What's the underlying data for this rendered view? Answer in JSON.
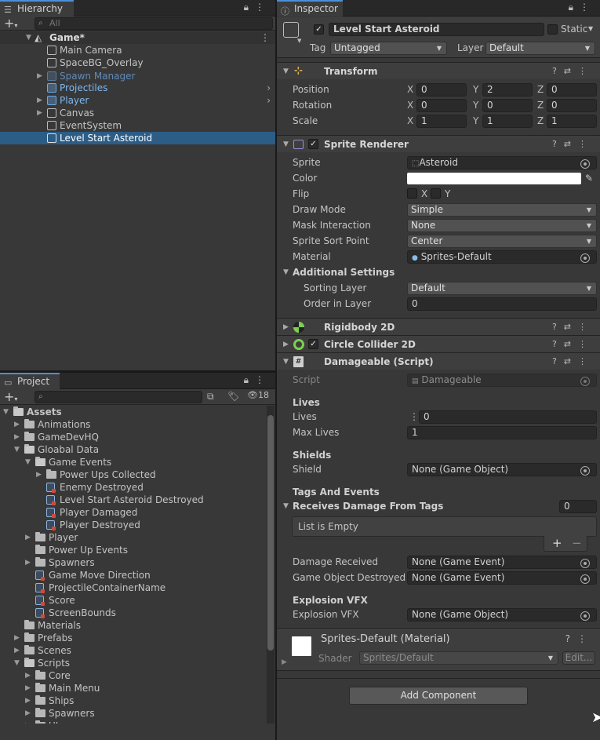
{
  "hierarchy": {
    "tab": "Hierarchy",
    "search_placeholder": "All",
    "scene": "Game*",
    "items": [
      {
        "label": "Main Camera"
      },
      {
        "label": "SpaceBG_Overlay"
      },
      {
        "label": "Spawn Manager"
      },
      {
        "label": "Projectiles"
      },
      {
        "label": "Player"
      },
      {
        "label": "Canvas"
      },
      {
        "label": "EventSystem"
      },
      {
        "label": "Level Start Asteroid"
      }
    ]
  },
  "project": {
    "tab": "Project",
    "count": "18",
    "items": [
      "Assets",
      "Animations",
      "GameDevHQ",
      "Gloabal Data",
      "Game Events",
      "Power Ups Collected",
      "Enemy Destroyed",
      "Level Start Asteroid Destroyed",
      "Player Damaged",
      "Player Destroyed",
      "Player",
      "Power Up Events",
      "Spawners",
      "Game Move Direction",
      "ProjectileContainerName",
      "Score",
      "ScreenBounds",
      "Materials",
      "Prefabs",
      "Scenes",
      "Scripts",
      "Core",
      "Main Menu",
      "Ships",
      "Spawners",
      "UI"
    ]
  },
  "inspector": {
    "tab": "Inspector",
    "object_name": "Level Start Asteroid",
    "static_label": "Static",
    "tag_label": "Tag",
    "tag_value": "Untagged",
    "layer_label": "Layer",
    "layer_value": "Default",
    "transform": {
      "title": "Transform",
      "position_label": "Position",
      "rotation_label": "Rotation",
      "scale_label": "Scale",
      "position": [
        "0",
        "2",
        "0"
      ],
      "rotation": [
        "0",
        "0",
        "0"
      ],
      "scale": [
        "1",
        "1",
        "1"
      ],
      "x": "X",
      "y": "Y",
      "z": "Z"
    },
    "sprite_renderer": {
      "title": "Sprite Renderer",
      "sprite_label": "Sprite",
      "sprite_value": "Asteroid",
      "color_label": "Color",
      "flip_label": "Flip",
      "flip_x": "X",
      "flip_y": "Y",
      "draw_mode_label": "Draw Mode",
      "draw_mode": "Simple",
      "mask_label": "Mask Interaction",
      "mask": "None",
      "sort_point_label": "Sprite Sort Point",
      "sort_point": "Center",
      "material_label": "Material",
      "material": "Sprites-Default",
      "additional": "Additional Settings",
      "sorting_layer_label": "Sorting Layer",
      "sorting_layer": "Default",
      "order_label": "Order in Layer",
      "order": "0"
    },
    "rigidbody": {
      "title": "Rigidbody 2D"
    },
    "collider": {
      "title": "Circle Collider 2D"
    },
    "damageable": {
      "title": "Damageable (Script)",
      "script_label": "Script",
      "script_value": "Damageable",
      "lives_header": "Lives",
      "lives_label": "Lives",
      "lives": "0",
      "max_lives_label": "Max Lives",
      "max_lives": "1",
      "shields_header": "Shields",
      "shield_label": "Shield",
      "shield": "None (Game Object)",
      "tags_header": "Tags And Events",
      "receives_label": "Receives Damage From Tags",
      "receives_count": "0",
      "list_empty": "List is Empty",
      "damage_received_label": "Damage Received",
      "damage_received": "None (Game Event)",
      "destroyed_label": "Game Object Destroyed",
      "destroyed": "None (Game Event)",
      "vfx_header": "Explosion VFX",
      "vfx_label": "Explosion VFX",
      "vfx": "None (Game Object)"
    },
    "material": {
      "title": "Sprites-Default (Material)",
      "shader_label": "Shader",
      "shader": "Sprites/Default",
      "edit": "Edit..."
    },
    "add_component": "Add Component"
  },
  "colors": {
    "accent": "#4a90d9",
    "selection": "#2c5d87",
    "background": "#383838"
  }
}
